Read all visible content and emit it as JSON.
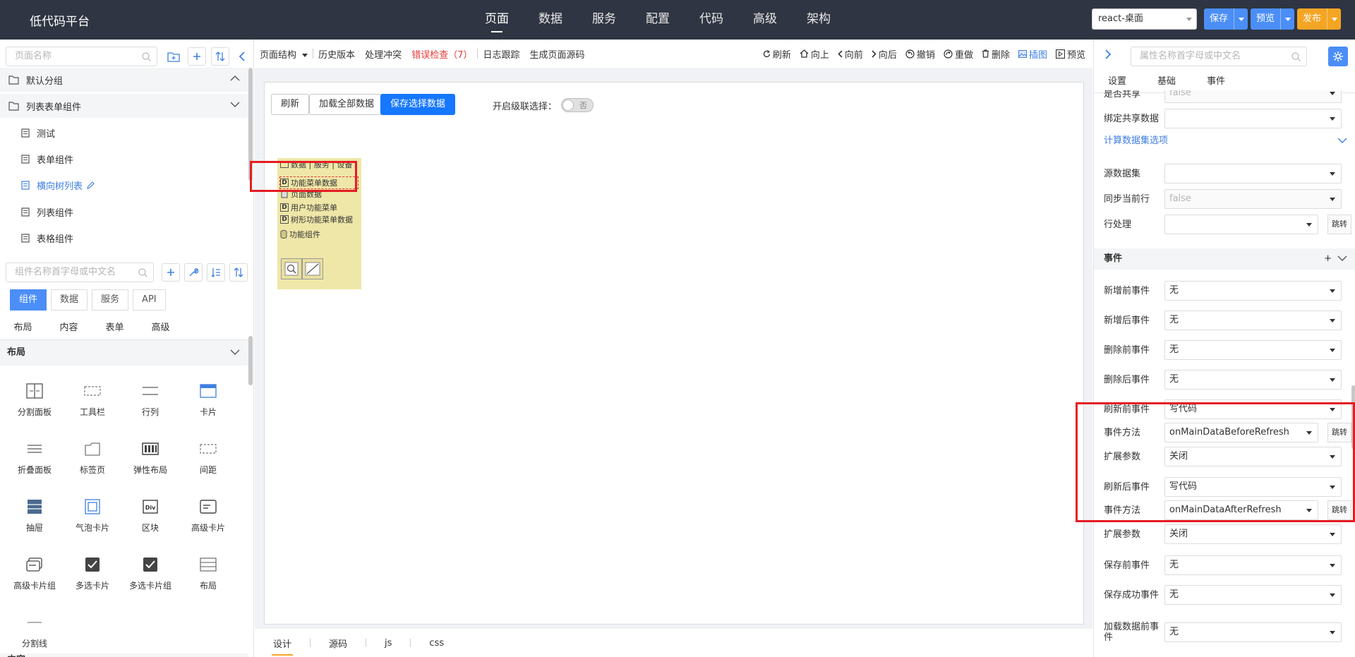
{
  "header": {
    "brand": "低代码平台",
    "nav": [
      "页面",
      "数据",
      "服务",
      "配置",
      "代码",
      "高级",
      "架构"
    ],
    "active_nav": "页面",
    "app_select": "react-桌面",
    "save_label": "保存",
    "preview_label": "预览",
    "publish_label": "发布",
    "colors": {
      "bar": "#2f3542",
      "blue": "#4b8ef7",
      "orange": "#f5a524"
    }
  },
  "sidebar": {
    "page_search_placeholder": "页面名称",
    "groups": [
      {
        "label": "默认分组",
        "expanded": false
      },
      {
        "label": "列表表单组件",
        "expanded": true
      }
    ],
    "pages": [
      {
        "label": "测试"
      },
      {
        "label": "表单组件"
      },
      {
        "label": "横向树列表"
      },
      {
        "label": "列表组件"
      },
      {
        "label": "表格组件"
      }
    ],
    "active_page": "横向树列表",
    "component_search_placeholder": "组件名称首字母或中文名",
    "tabs": [
      "组件",
      "数据",
      "服务",
      "API"
    ],
    "active_tab": "组件",
    "subtabs": [
      "布局",
      "内容",
      "表单",
      "高级"
    ],
    "section_title": "布局",
    "components": [
      {
        "label": "分割面板",
        "icon": "split-panel-icon"
      },
      {
        "label": "工具栏",
        "icon": "toolbar-icon"
      },
      {
        "label": "行列",
        "icon": "row-col-icon"
      },
      {
        "label": "卡片",
        "icon": "card-icon"
      },
      {
        "label": "折叠面板",
        "icon": "collapse-icon"
      },
      {
        "label": "标签页",
        "icon": "tabs-icon"
      },
      {
        "label": "弹性布局",
        "icon": "flex-icon"
      },
      {
        "label": "间距",
        "icon": "spacing-icon"
      },
      {
        "label": "抽屉",
        "icon": "drawer-icon"
      },
      {
        "label": "气泡卡片",
        "icon": "bubble-card-icon"
      },
      {
        "label": "区块",
        "icon": "div-icon"
      },
      {
        "label": "高级卡片",
        "icon": "advanced-card-icon"
      },
      {
        "label": "高级卡片组",
        "icon": "advanced-card-group-icon"
      },
      {
        "label": "多选卡片",
        "icon": "checkbox-card-icon"
      },
      {
        "label": "多选卡片组",
        "icon": "checkbox-card-group-icon"
      },
      {
        "label": "布局",
        "icon": "layout-icon"
      },
      {
        "label": "分割线",
        "icon": "divider-icon"
      }
    ],
    "next_section": "内容"
  },
  "center": {
    "toolbar_left": [
      "页面结构",
      "历史版本",
      "处理冲突",
      "错误检查（7）",
      "日志跟踪",
      "生成页面源码"
    ],
    "toolbar_right": [
      {
        "label": "刷新",
        "icon": "refresh-icon"
      },
      {
        "label": "向上",
        "icon": "home-icon"
      },
      {
        "label": "向前",
        "icon": "chevron-left-icon"
      },
      {
        "label": "向后",
        "icon": "chevron-right-icon"
      },
      {
        "label": "撤销",
        "icon": "undo-icon"
      },
      {
        "label": "重做",
        "icon": "redo-icon"
      },
      {
        "label": "删除",
        "icon": "trash-icon"
      },
      {
        "label": "插图",
        "icon": "image-icon"
      },
      {
        "label": "预览",
        "icon": "play-icon"
      }
    ],
    "canvas_buttons": [
      "刷新",
      "加载全部数据",
      "保存选择数据"
    ],
    "cascade_label": "开启级联选择：",
    "toggle_label": "否",
    "tree": {
      "header": "数据 | 服务 | 设备",
      "items": [
        "功能菜单数据",
        "页面数据",
        "用户功能菜单",
        "树形功能菜单数据"
      ],
      "selected": "功能菜单数据",
      "components_header": "功能组件"
    },
    "bottom_tabs": [
      "设计",
      "源码",
      "js",
      "css"
    ],
    "active_bottom_tab": "设计"
  },
  "right": {
    "search_placeholder": "属性名称首字母或中文名",
    "tabs": [
      "设置",
      "基础",
      "事件"
    ],
    "jump_label": "跳转",
    "rows_top": [
      {
        "label": "是否共享",
        "value": "false",
        "disabled": true
      },
      {
        "label": "绑定共享数据",
        "value": ""
      }
    ],
    "calc_section": "计算数据集选项",
    "calc_rows": [
      {
        "label": "源数据集",
        "value": ""
      },
      {
        "label": "同步当前行",
        "value": "false",
        "disabled": true
      },
      {
        "label": "行处理",
        "value": "",
        "jump": true
      }
    ],
    "event_section": "事件",
    "event_rows": [
      {
        "label": "新增前事件",
        "value": "无"
      },
      {
        "label": "新增后事件",
        "value": "无"
      },
      {
        "label": "删除前事件",
        "value": "无"
      },
      {
        "label": "删除后事件",
        "value": "无"
      },
      {
        "label": "刷新前事件",
        "value": "写代码"
      },
      {
        "label": "事件方法",
        "value": "onMainDataBeforeRefresh",
        "jump": true
      },
      {
        "label": "扩展参数",
        "value": "关闭"
      },
      {
        "label": "刷新后事件",
        "value": "写代码"
      },
      {
        "label": "事件方法",
        "value": "onMainDataAfterRefresh",
        "jump": true
      },
      {
        "label": "扩展参数",
        "value": "关闭"
      },
      {
        "label": "保存前事件",
        "value": "无"
      },
      {
        "label": "保存成功事件",
        "value": "无"
      },
      {
        "label": "加载数据前事件",
        "value": "无"
      }
    ]
  }
}
